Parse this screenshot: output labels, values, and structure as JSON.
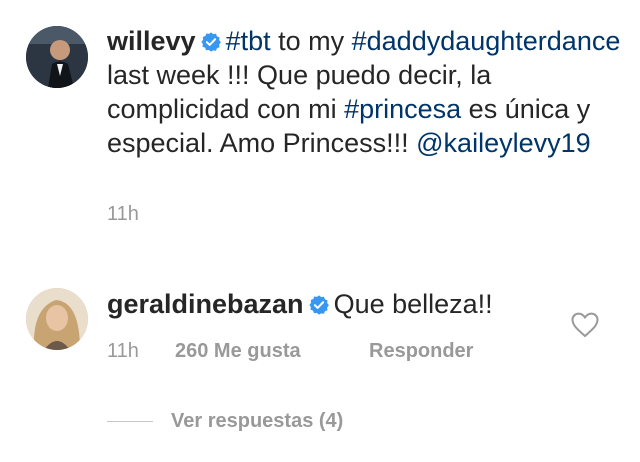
{
  "post": {
    "username": "willevy",
    "verified": true,
    "caption_parts": [
      {
        "text": "#tbt",
        "type": "tag"
      },
      {
        "text": " to my ",
        "type": "plain"
      },
      {
        "text": "#daddydaughterdance",
        "type": "tag"
      },
      {
        "text": " last week !!! Que puedo decir, la complicidad con mi ",
        "type": "plain"
      },
      {
        "text": "#princesa",
        "type": "tag"
      },
      {
        "text": " es única y especial. Amo Princess!!! ",
        "type": "plain"
      },
      {
        "text": "@kaileylevy19",
        "type": "tag"
      }
    ],
    "time": "11h"
  },
  "comment": {
    "username": "geraldinebazan",
    "verified": true,
    "text": "Que belleza!!",
    "time": "11h",
    "likes": "260 Me gusta",
    "reply_label": "Responder",
    "heart_icon": "heart-outline-icon"
  },
  "replies": {
    "label": "Ver respuestas (4)"
  },
  "colors": {
    "tag": "#003569",
    "verified": "#3897f0",
    "muted": "#999999",
    "text": "#262626"
  }
}
